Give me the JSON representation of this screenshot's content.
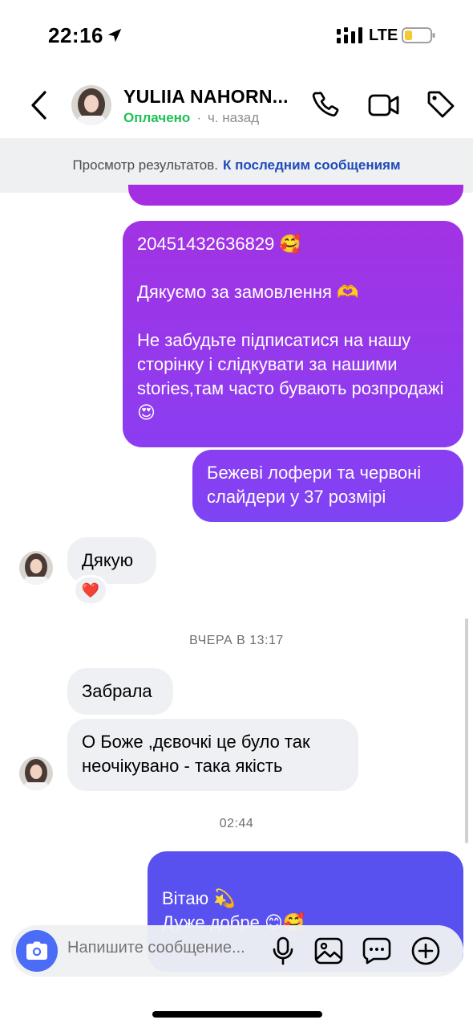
{
  "status_bar": {
    "time": "22:16",
    "network": "LTE"
  },
  "header": {
    "contact_name": "YULIIA NAHORN...",
    "status_label": "Оплачено",
    "dot": "·",
    "last_seen": "ч. назад"
  },
  "banner": {
    "text": "Просмотр результатов.",
    "link": "К последним сообщениям"
  },
  "messages": {
    "out1": "20451432636829 🥰\n\nДякуємо за замовлення 🫶\n\nНе забудьте підписатися на нашу сторінку і слідкувати за нашими stories,там часто бувають розпродажі 😍",
    "out2": "Бежеві лофери та червоні слайдери у 37 розмірі",
    "in1": "Дякую",
    "in1_reaction": "❤️",
    "timestamp1": "ВЧЕРА В 13:17",
    "in2": "Забрала",
    "in3": "О Боже ,дєвочкі це було так неочікувано - така якість",
    "timestamp2": "02:44",
    "out3": "Вітаю 💫\nДуже добре 😊🥰"
  },
  "composer": {
    "placeholder": "Напишите сообщение..."
  },
  "colors": {
    "accent_green": "#1fc155",
    "link_blue": "#1f4ab8",
    "bubble_purple": "#a233e3",
    "bubble_violet": "#5850ef",
    "incoming_gray": "#eef0f3",
    "camera_blue": "#4a6cf7"
  }
}
